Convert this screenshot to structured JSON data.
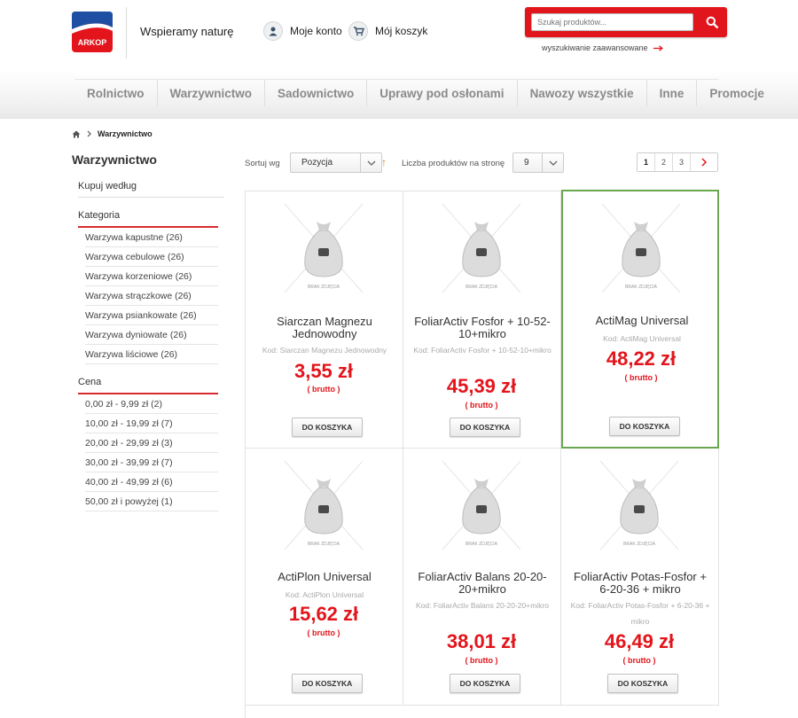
{
  "header": {
    "logo_text": "ARKOP",
    "tagline": "Wspieramy naturę",
    "account_label": "Moje konto",
    "cart_label": "Mój koszyk",
    "search_placeholder": "Szukaj produktów...",
    "advanced_search_label": "wyszukiwanie zaawansowane"
  },
  "nav": {
    "items": [
      "Rolnictwo",
      "Warzywnictwo",
      "Sadownictwo",
      "Uprawy pod osłonami",
      "Nawozy wszystkie",
      "Inne",
      "Promocje"
    ]
  },
  "breadcrumb": {
    "current": "Warzywnictwo"
  },
  "sidebar": {
    "title": "Warzywnictwo",
    "shop_by": "Kupuj według",
    "category_heading": "Kategoria",
    "categories": [
      "Warzywa kapustne (26)",
      "Warzywa cebulowe (26)",
      "Warzywa korzeniowe (26)",
      "Warzywa strączkowe (26)",
      "Warzywa psiankowate (26)",
      "Warzywa dyniowate (26)",
      "Warzywa liściowe (26)"
    ],
    "price_heading": "Cena",
    "prices": [
      "0,00 zł - 9,99 zł (2)",
      "10,00 zł - 19,99 zł (7)",
      "20,00 zł - 29,99 zł (3)",
      "30,00 zł - 39,99 zł (7)",
      "40,00 zł - 49,99 zł (6)",
      "50,00 zł i powyżej (1)"
    ]
  },
  "toolbar": {
    "sort_label": "Sortuj wg",
    "sort_value": "Pozycja",
    "per_page_label": "Liczba produktów na stronę",
    "per_page_value": "9",
    "pages": [
      "1",
      "2",
      "3"
    ]
  },
  "products": [
    {
      "title": "Siarczan Magnezu Jednowodny",
      "code": "Kod: Siarczan Magnezu Jednowodny",
      "price": "3,55 zł",
      "brutto": "( brutto )",
      "button": "DO KOSZYKA",
      "image_label": "BRAK ZDJĘCIA"
    },
    {
      "title": "FoliarActiv Fosfor + 10-52-10+mikro",
      "code": "Kod: FoliarActiv Fosfor + 10-52-10+mikro",
      "price": "45,39 zł",
      "brutto": "( brutto )",
      "button": "DO KOSZYKA",
      "image_label": "BRAK ZDJĘCIA"
    },
    {
      "title": "ActiMag Universal",
      "code": "Kod: ActiMag Universal",
      "price": "48,22 zł",
      "brutto": "( brutto )",
      "button": "DO KOSZYKA",
      "image_label": "BRAK ZDJĘCIA"
    },
    {
      "title": "ActiPlon Universal",
      "code": "Kod: ActiPlon Universal",
      "price": "15,62 zł",
      "brutto": "( brutto )",
      "button": "DO KOSZYKA",
      "image_label": "BRAK ZDJĘCIA"
    },
    {
      "title": "FoliarActiv Balans 20-20-20+mikro",
      "code": "Kod: FoliarActiv Balans 20-20-20+mikro",
      "price": "38,01 zł",
      "brutto": "( brutto )",
      "button": "DO KOSZYKA",
      "image_label": "BRAK ZDJĘCIA"
    },
    {
      "title": "FoliarActiv Potas-Fosfor + 6-20-36 + mikro",
      "code": "Kod: FoliarActiv Potas-Fosfor + 6-20-36 + mikro",
      "price": "46,49 zł",
      "brutto": "( brutto )",
      "button": "DO KOSZYKA",
      "image_label": "BRAK ZDJĘCIA"
    }
  ],
  "colors": {
    "accent_red": "#e3141b",
    "selected_border": "#6aa84f",
    "logo_blue": "#1f4fa3"
  }
}
